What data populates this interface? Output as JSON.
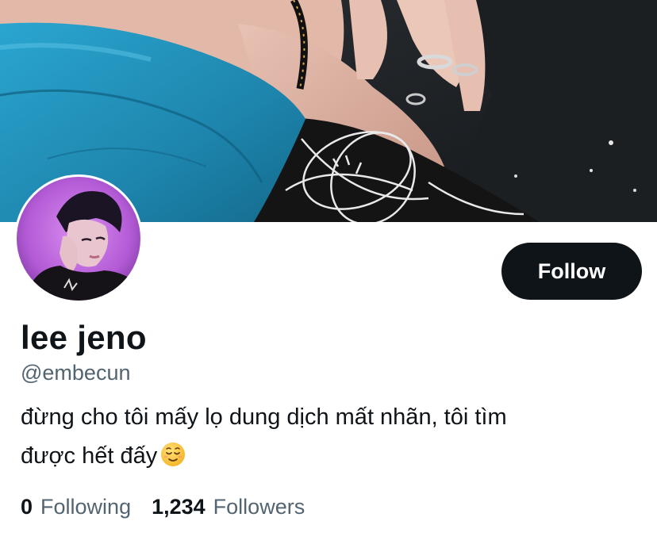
{
  "profile": {
    "display_name": "lee jeno",
    "handle": "@embecun",
    "bio_line1": "đừng cho tôi mấy lọ dung dịch mất nhãn, tôi tìm",
    "bio_line2": "được hết đấy",
    "bio_emoji": "relieved-face-emoji",
    "follow_label": "Follow",
    "following_count": "0",
    "following_label": "Following",
    "followers_count": "1,234",
    "followers_label": "Followers"
  },
  "colors": {
    "text_primary": "#0f1419",
    "text_secondary": "#536471",
    "button_bg": "#0f1419",
    "button_text": "#ffffff",
    "banner_jacket": "#1f8fb8",
    "avatar_glow": "#c26ce0"
  }
}
